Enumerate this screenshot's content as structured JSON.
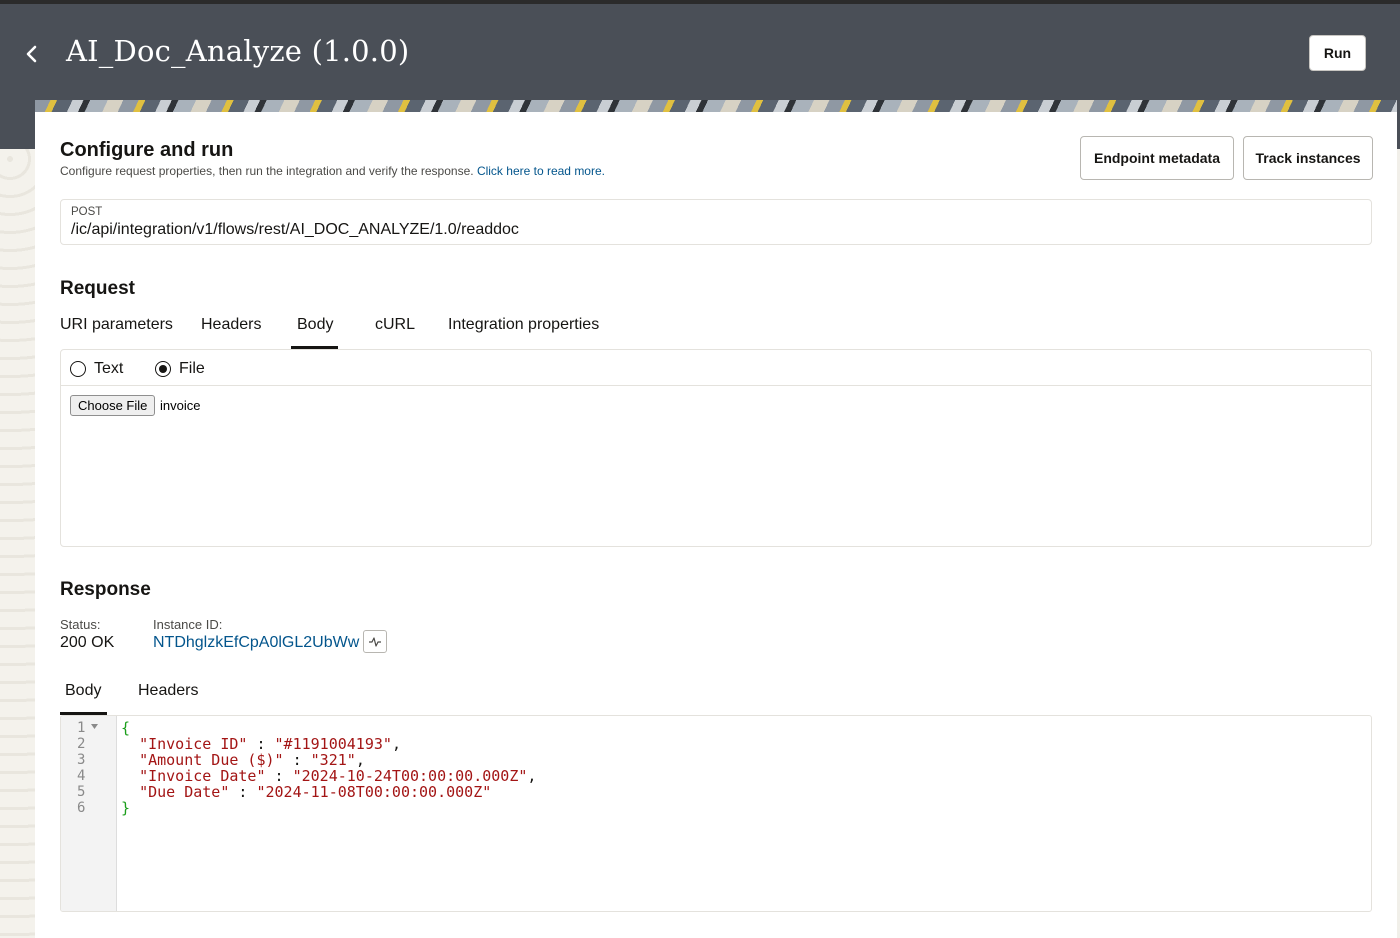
{
  "header": {
    "title": "AI_Doc_Analyze (1.0.0)",
    "run_label": "Run"
  },
  "configure": {
    "title": "Configure and run",
    "description": "Configure request properties, then run the integration and verify the response.",
    "learn_more": "Click here to read more.",
    "endpoint_metadata_label": "Endpoint metadata",
    "track_instances_label": "Track instances"
  },
  "endpoint": {
    "method": "POST",
    "path": "/ic/api/integration/v1/flows/rest/AI_DOC_ANALYZE/1.0/readdoc"
  },
  "request": {
    "title": "Request",
    "tabs": [
      "URI parameters",
      "Headers",
      "Body",
      "cURL",
      "Integration properties"
    ],
    "active_tab": "Body",
    "radio_text": "Text",
    "radio_file": "File",
    "selected_radio": "File",
    "choose_file_label": "Choose File",
    "file_name": "invoice"
  },
  "response": {
    "title": "Response",
    "status_label": "Status:",
    "status_value": "200 OK",
    "instance_label": "Instance ID:",
    "instance_value": "NTDhglzkEfCpA0lGL2UbWw",
    "tabs": [
      "Body",
      "Headers"
    ],
    "active_tab": "Body",
    "line_numbers": [
      "1",
      "2",
      "3",
      "4",
      "5",
      "6"
    ],
    "code": {
      "open": "{",
      "lines": [
        {
          "key": "\"Invoice ID\"",
          "value": "\"#1191004193\"",
          "comma": ","
        },
        {
          "key": "\"Amount Due ($)\"",
          "value": "\"321\"",
          "comma": ","
        },
        {
          "key": "\"Invoice Date\"",
          "value": "\"2024-10-24T00:00:00.000Z\"",
          "comma": ","
        },
        {
          "key": "\"Due Date\"",
          "value": "\"2024-11-08T00:00:00.000Z\"",
          "comma": ""
        }
      ],
      "close": "}"
    }
  },
  "icons": {
    "back": "chevron-left-icon",
    "activity": "activity-icon",
    "fold": "fold-arrow-icon"
  },
  "colors": {
    "header_bg": "#4a4f57",
    "link": "#03558c",
    "json_string": "#a31515",
    "json_brace": "#1b9e1b"
  }
}
